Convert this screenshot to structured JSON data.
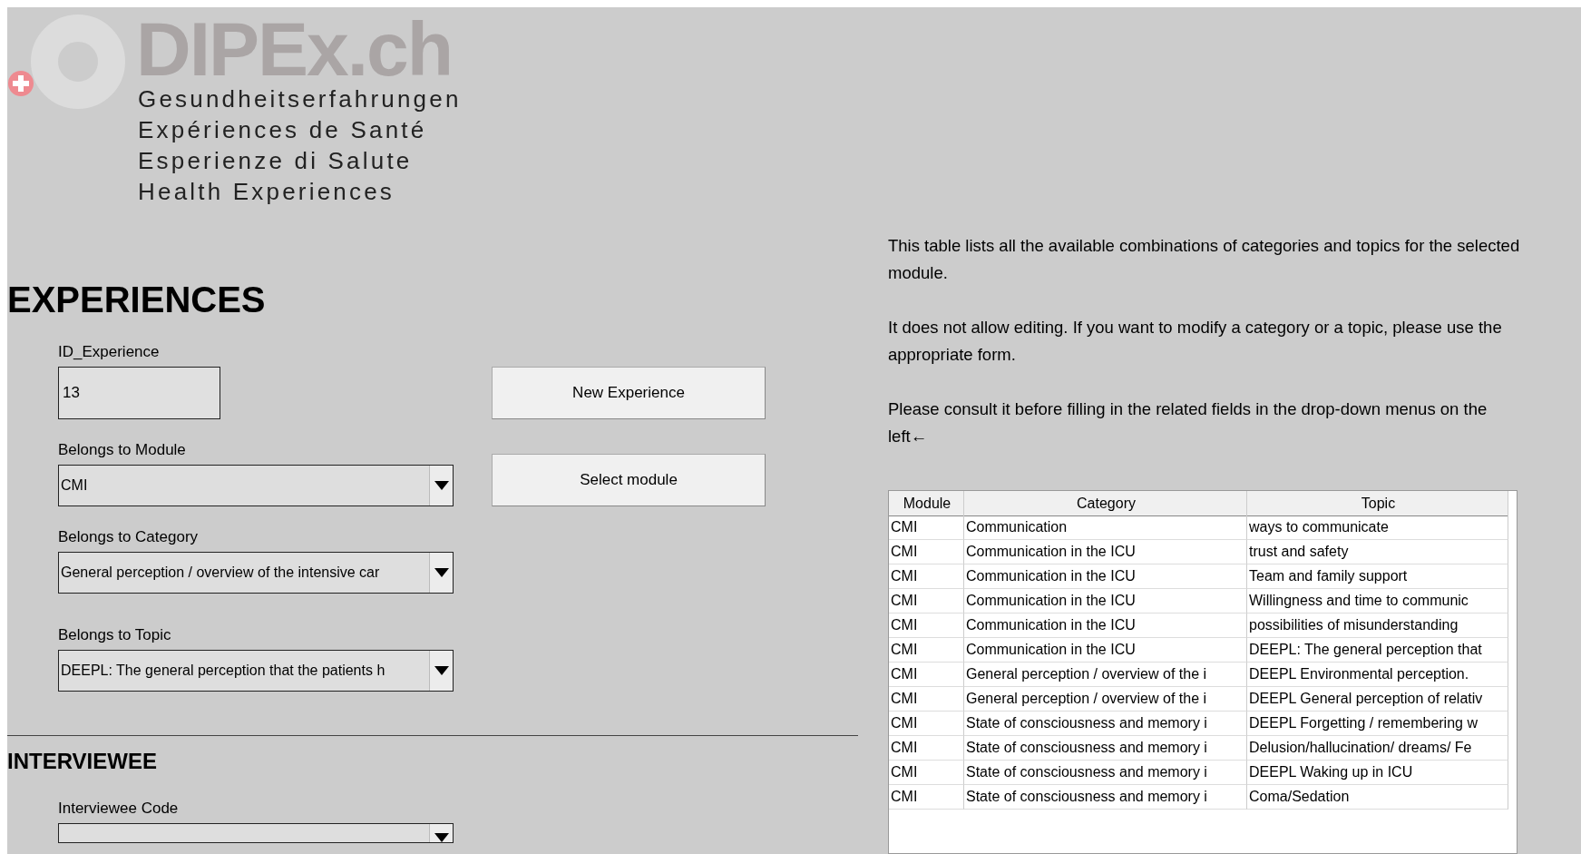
{
  "logo": {
    "name": "DIPEx.ch",
    "taglines": [
      "Gesundheitserfahrungen",
      "Expériences de Santé",
      "Esperienze di Salute",
      "Health Experiences"
    ]
  },
  "experiences": {
    "title": "EXPERIENCES",
    "fields": [
      {
        "kind": "input",
        "label": "ID_Experience",
        "value": "13"
      },
      {
        "kind": "dropdown",
        "label": "Belongs to Module",
        "value": "CMI"
      },
      {
        "kind": "dropdown",
        "label": "Belongs to Category",
        "value": "General perception / overview of the intensive car"
      },
      {
        "kind": "dropdown",
        "label": "Belongs to Topic",
        "value": "DEEPL: The general perception that the patients h"
      }
    ]
  },
  "buttons": [
    "New Experience",
    "Select module"
  ],
  "interviewee": {
    "title": "INTERVIEWEE",
    "fields": [
      {
        "kind": "dropdown",
        "label": "Interviewee Code"
      }
    ]
  },
  "info": {
    "paragraphs": [
      "This table lists all the available combinations of categories and topics for the selected module.",
      "It does not allow editing. If you want to modify a category or a topic, please use the appropriate form.",
      "Please consult it before filling in the related fields in the drop-down menus on the left←"
    ]
  },
  "table": {
    "columns": [
      "Module",
      "Category",
      "Topic"
    ],
    "rows": [
      [
        "CMI",
        "Communication",
        "ways to communicate"
      ],
      [
        "CMI",
        "Communication in the ICU",
        "trust and safety"
      ],
      [
        "CMI",
        "Communication in the ICU",
        "Team and family support"
      ],
      [
        "CMI",
        "Communication in the ICU",
        "Willingness and time to communic"
      ],
      [
        "CMI",
        "Communication in the ICU",
        "possibilities of misunderstanding"
      ],
      [
        "CMI",
        "Communication in the ICU",
        "DEEPL: The general perception that"
      ],
      [
        "CMI",
        "General perception / overview of the i",
        "DEEPL Environmental perception."
      ],
      [
        "CMI",
        "General perception / overview of the i",
        "DEEPL General perception of relativ"
      ],
      [
        "CMI",
        "State of consciousness and memory i",
        "DEEPL Forgetting / remembering w"
      ],
      [
        "CMI",
        "State of consciousness and memory i",
        "Delusion/hallucination/ dreams/ Fe"
      ],
      [
        "CMI",
        "State of consciousness and memory i",
        "DEEPL Waking up in ICU"
      ],
      [
        "CMI",
        "State of consciousness and memory i",
        "Coma/Sedation"
      ]
    ]
  }
}
